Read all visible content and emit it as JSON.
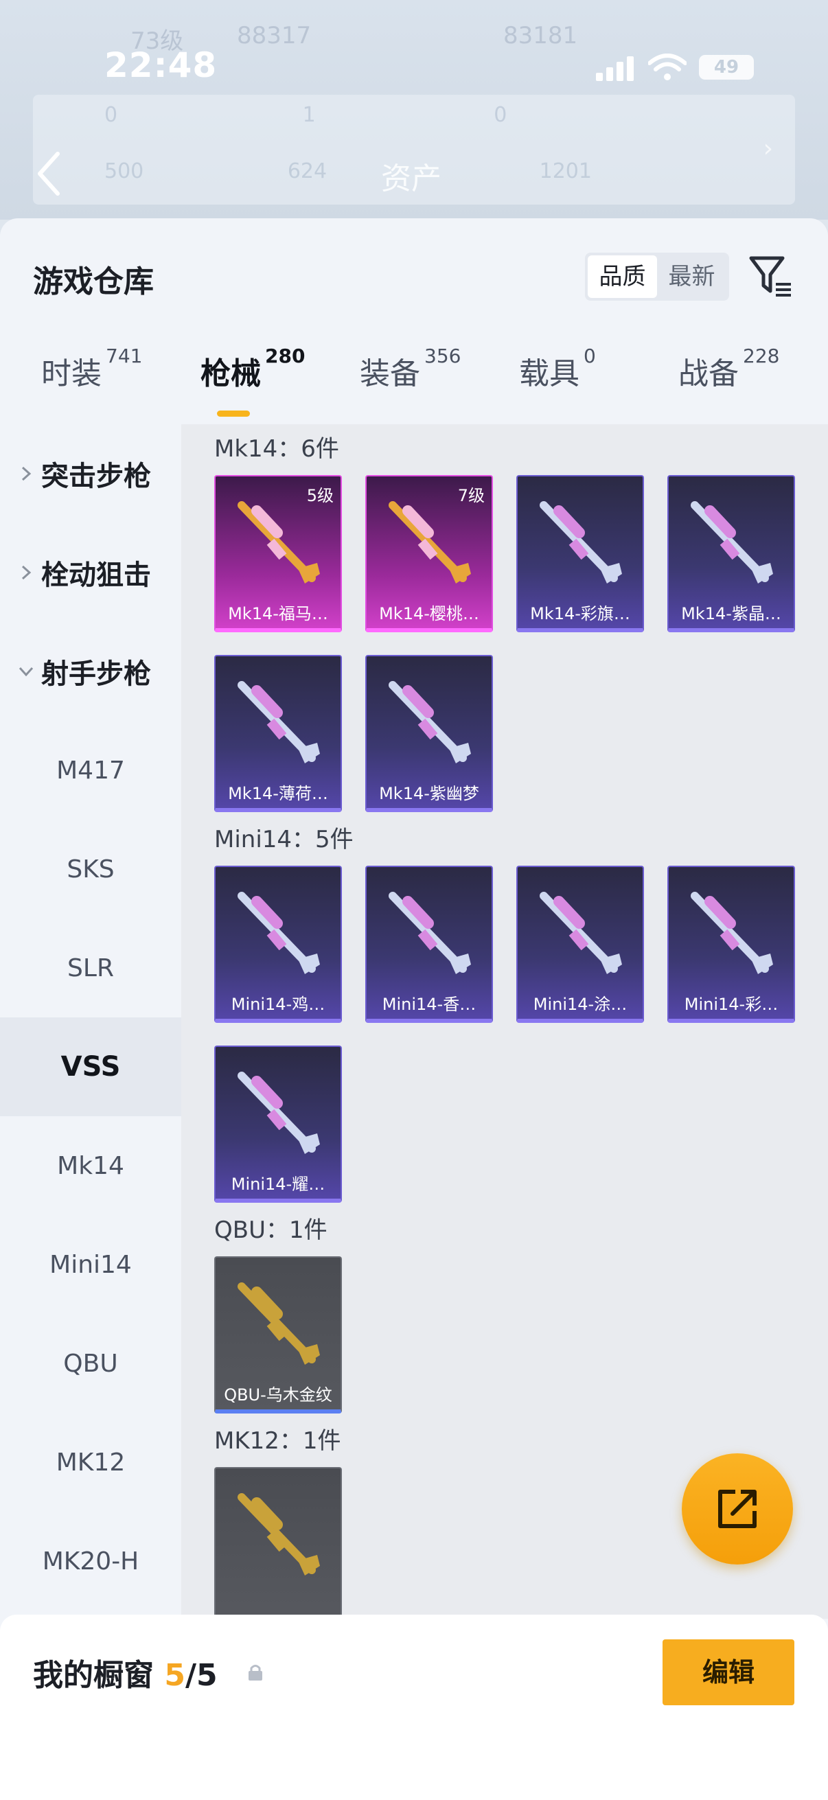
{
  "status_bar": {
    "time": "22:48",
    "battery": "49"
  },
  "backdrop": {
    "level_text": "73级",
    "coins_a": "88317",
    "coins_b": "83181",
    "row1": [
      "0",
      "1",
      "0"
    ],
    "row2": [
      "500",
      "624",
      "1201"
    ],
    "asset_title": "资产"
  },
  "header": {
    "title": "游戏仓库",
    "sort_options": [
      "品质",
      "最新"
    ],
    "active_sort": "品质"
  },
  "tabs": [
    {
      "label": "时装",
      "count": "741"
    },
    {
      "label": "枪械",
      "count": "280"
    },
    {
      "label": "装备",
      "count": "356"
    },
    {
      "label": "载具",
      "count": "0"
    },
    {
      "label": "战备",
      "count": "228"
    }
  ],
  "active_tab": "枪械",
  "sidebar": {
    "groups": [
      "突击步枪",
      "栓动狙击",
      "射手步枪"
    ],
    "items": [
      "M417",
      "SKS",
      "SLR",
      "VSS",
      "Mk14",
      "Mini14",
      "QBU",
      "MK12",
      "MK20-H"
    ],
    "selected": "VSS"
  },
  "weapon_groups": [
    {
      "title": "Mk14：6件",
      "items": [
        {
          "name": "Mk14-福马…",
          "level": "5级",
          "rarity": "pink"
        },
        {
          "name": "Mk14-樱桃…",
          "level": "7级",
          "rarity": "pink"
        },
        {
          "name": "Mk14-彩旗…",
          "level": "",
          "rarity": "purple"
        },
        {
          "name": "Mk14-紫晶…",
          "level": "",
          "rarity": "purple"
        },
        {
          "name": "Mk14-薄荷…",
          "level": "",
          "rarity": "purple"
        },
        {
          "name": "Mk14-紫幽梦",
          "level": "",
          "rarity": "purple"
        }
      ]
    },
    {
      "title": "Mini14：5件",
      "items": [
        {
          "name": "Mini14-鸡…",
          "level": "",
          "rarity": "purple"
        },
        {
          "name": "Mini14-香…",
          "level": "",
          "rarity": "purple"
        },
        {
          "name": "Mini14-涂…",
          "level": "",
          "rarity": "purple"
        },
        {
          "name": "Mini14-彩…",
          "level": "",
          "rarity": "purple"
        },
        {
          "name": "Mini14-耀…",
          "level": "",
          "rarity": "purple"
        }
      ]
    },
    {
      "title": "QBU：1件",
      "items": [
        {
          "name": "QBU-乌木金纹",
          "level": "",
          "rarity": "gray"
        }
      ]
    },
    {
      "title": "MK12：1件",
      "items": [
        {
          "name": "",
          "level": "",
          "rarity": "gray"
        }
      ]
    }
  ],
  "showcase": {
    "label": "我的橱窗",
    "count": "5",
    "separator": "/",
    "total": "5"
  },
  "edit_button": "编辑",
  "colors": {
    "accent": "#f7ad1f",
    "pink_rarity": "#e24de2",
    "purple_rarity": "#6a5bd0",
    "gray_rarity": "#5b7ff2"
  }
}
